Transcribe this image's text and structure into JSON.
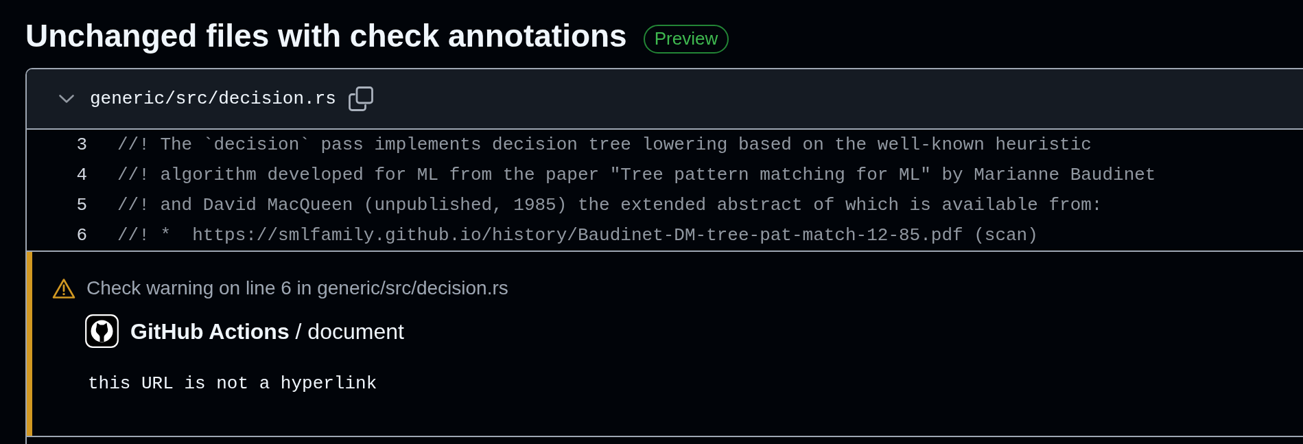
{
  "heading": {
    "title": "Unchanged files with check annotations",
    "badge": "Preview"
  },
  "file": {
    "path": "generic/src/decision.rs",
    "expanded": true,
    "lines": [
      {
        "number": "3",
        "code": "//! The `decision` pass implements decision tree lowering based on the well-known heuristic"
      },
      {
        "number": "4",
        "code": "//! algorithm developed for ML from the paper \"Tree pattern matching for ML\" by Marianne Baudinet"
      },
      {
        "number": "5",
        "code": "//! and David MacQueen (unpublished, 1985) the extended abstract of which is available from:"
      },
      {
        "number": "6",
        "code": "//! *  https://smlfamily.github.io/history/Baudinet-DM-tree-pat-match-12-85.pdf (scan)"
      }
    ],
    "annotation": {
      "kind": "warning",
      "title": "Check warning on line 6 in generic/src/decision.rs",
      "source": "**GitHub Actions** / document",
      "message": "this URL is not a hyperlink"
    }
  }
}
